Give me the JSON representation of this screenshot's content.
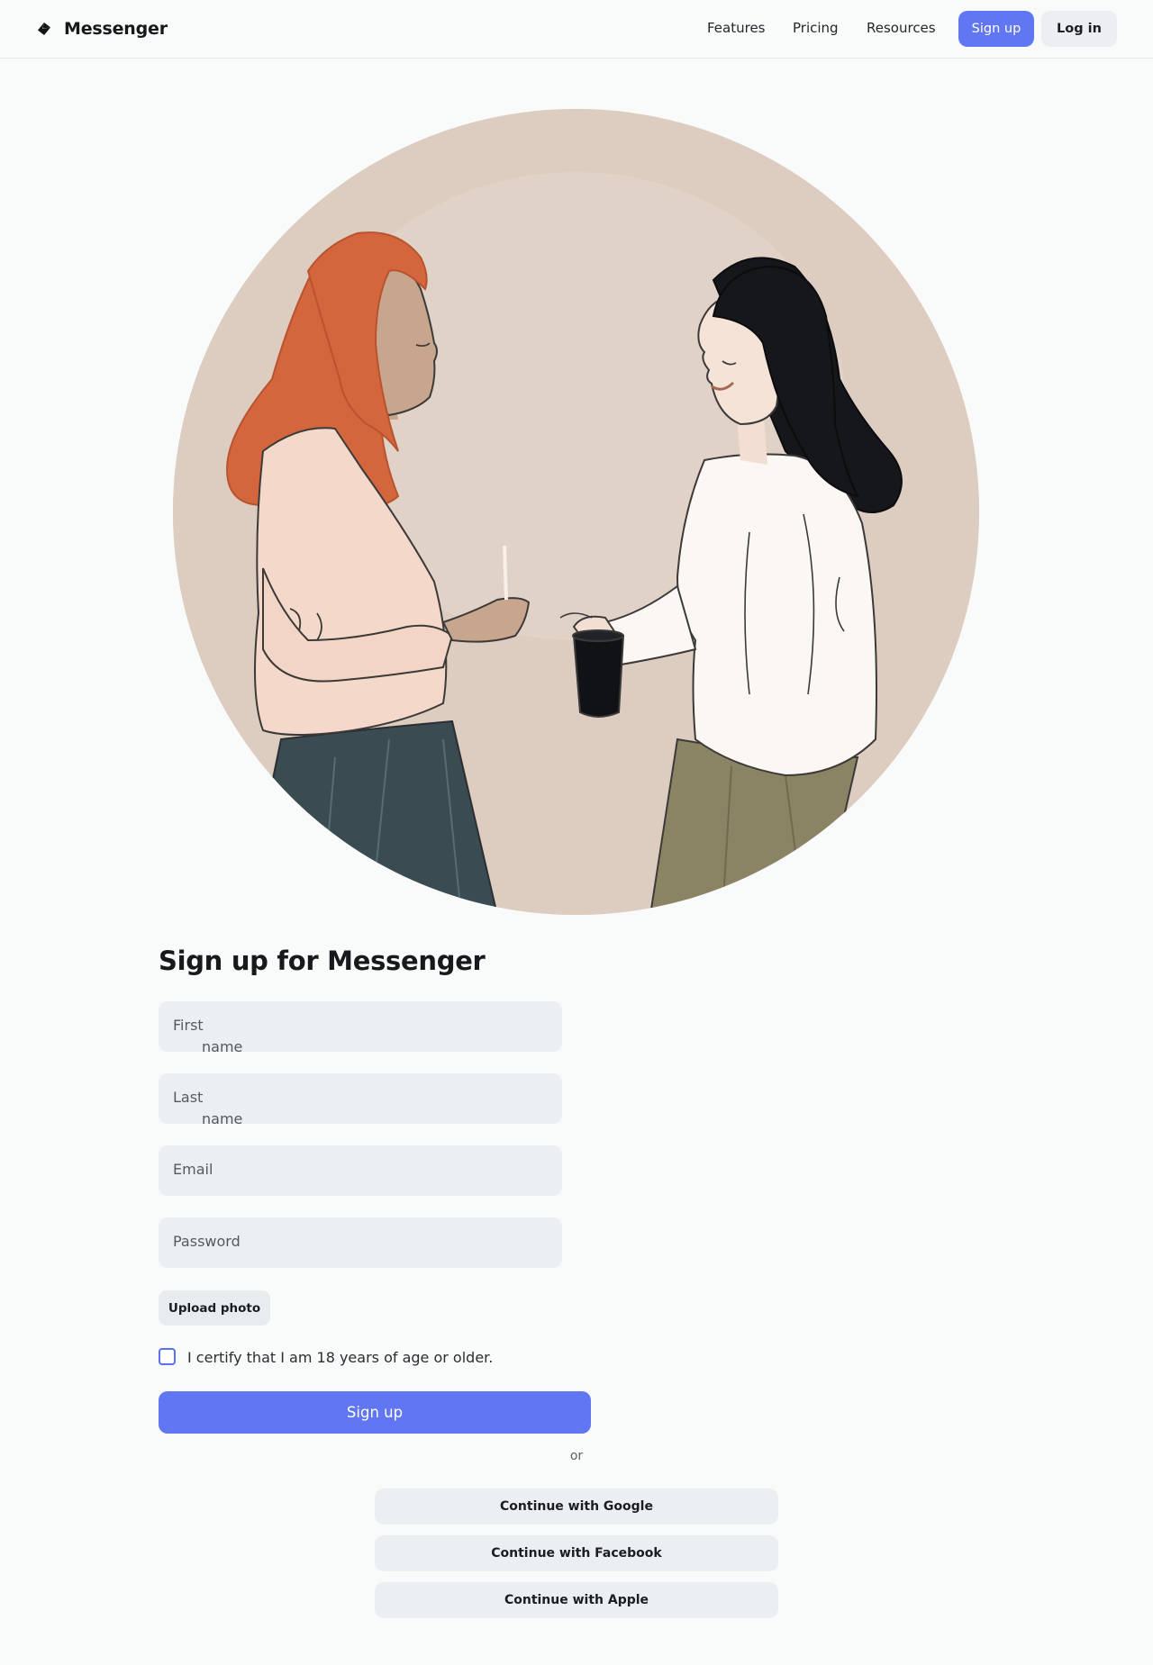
{
  "header": {
    "brand": "Messenger",
    "brand_icon": "messenger-logo-icon",
    "nav": [
      "Features",
      "Pricing",
      "Resources"
    ],
    "signup_label": "Sign up",
    "login_label": "Log in"
  },
  "hero": {
    "image": "illustration-two-women-chatting-with-coffee"
  },
  "form": {
    "title": "Sign up for Messenger",
    "first_name": [
      "First",
      "name"
    ],
    "last_name": [
      "Last",
      "name"
    ],
    "email": "Email",
    "password": "Password",
    "upload_label": "Upload photo",
    "age_check": "I certify that I am 18 years of age or older.",
    "age_checked": false,
    "submit_label": "Sign up"
  },
  "divider": "or",
  "social": {
    "google": "Continue with Google",
    "facebook": "Continue with Facebook",
    "apple": "Continue with Apple"
  },
  "colors": {
    "accent": "#6176f2",
    "field_bg": "#eceff2",
    "page_bg": "#f9fafa",
    "hero_bg": "#ddcdc0"
  }
}
